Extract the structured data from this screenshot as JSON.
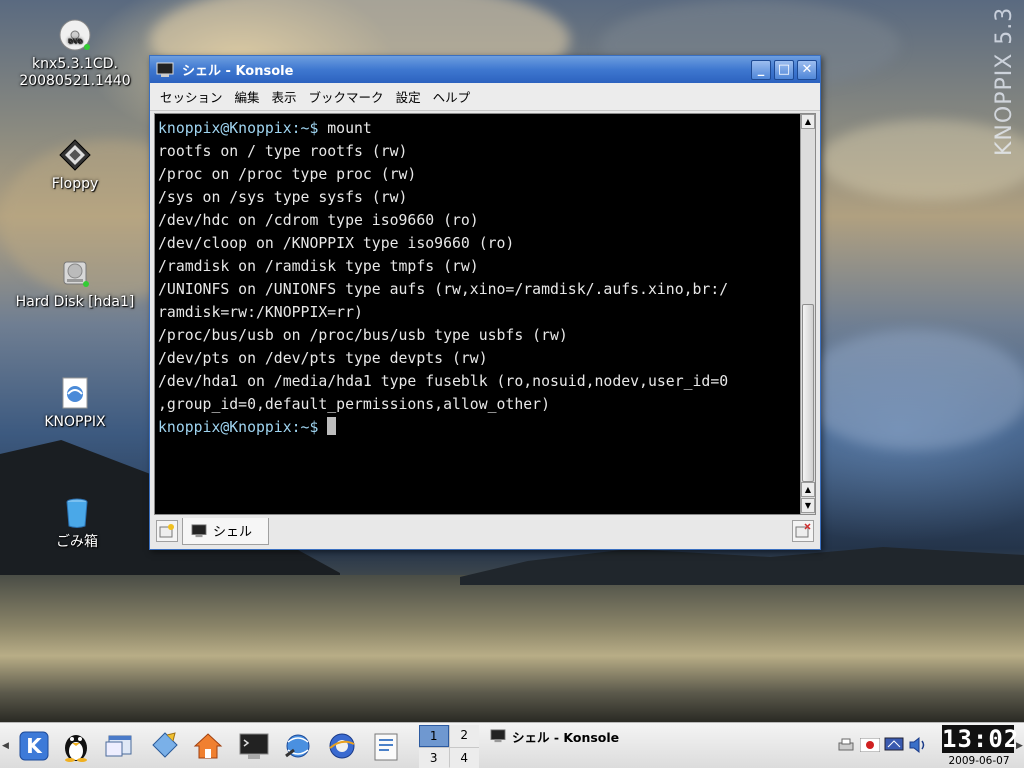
{
  "desktop": {
    "brand_text": "KNOPPIX 5.3",
    "icons": [
      {
        "name": "dvd-icon",
        "label_line1": "knx5.3.1CD.",
        "label_line2": "20080521.1440"
      },
      {
        "name": "floppy-icon",
        "label": "Floppy"
      },
      {
        "name": "hard-disk-icon",
        "label": "Hard Disk [hda1]"
      },
      {
        "name": "knoppix-icon",
        "label": "KNOPPIX"
      },
      {
        "name": "trash-icon",
        "label": "ごみ箱"
      }
    ]
  },
  "window": {
    "title": "シェル - Konsole",
    "buttons": {
      "minimize": "_",
      "maximize": "□",
      "close": "✕"
    },
    "menu": [
      "セッション",
      "編集",
      "表示",
      "ブックマーク",
      "設定",
      "ヘルプ"
    ],
    "terminal": {
      "prompt": "knoppix@Knoppix:~$",
      "command": " mount",
      "output": [
        "rootfs on / type rootfs (rw)",
        "/proc on /proc type proc (rw)",
        "/sys on /sys type sysfs (rw)",
        "/dev/hdc on /cdrom type iso9660 (ro)",
        "/dev/cloop on /KNOPPIX type iso9660 (ro)",
        "/ramdisk on /ramdisk type tmpfs (rw)",
        "/UNIONFS on /UNIONFS type aufs (rw,xino=/ramdisk/.aufs.xino,br:/",
        "ramdisk=rw:/KNOPPIX=rr)",
        "/proc/bus/usb on /proc/bus/usb type usbfs (rw)",
        "/dev/pts on /dev/pts type devpts (rw)",
        "/dev/hda1 on /media/hda1 type fuseblk (ro,nosuid,nodev,user_id=0",
        ",group_id=0,default_permissions,allow_other)"
      ],
      "final_prompt": "knoppix@Knoppix:~$"
    },
    "tab_label": "シェル"
  },
  "taskbar": {
    "pager": [
      "1",
      "2",
      "3",
      "4"
    ],
    "active_desktop": "1",
    "task_title": "シェル - Konsole",
    "clock": "13:02",
    "date": "2009-06-07"
  }
}
